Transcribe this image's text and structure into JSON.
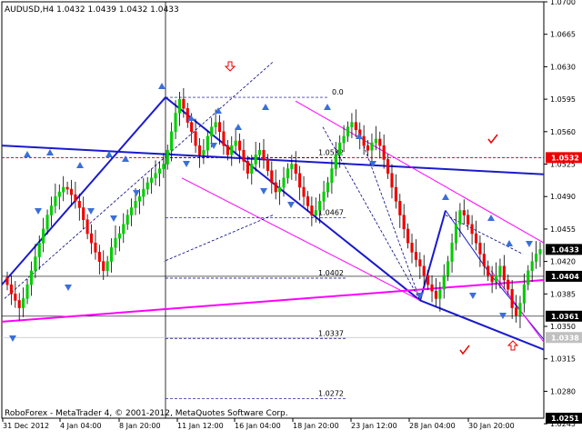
{
  "header": {
    "symbol_info": "AUDUSD,H4  1.0432 1.0439 1.0432 1.0433"
  },
  "footer": {
    "copyright": "RoboForex - MetaTrader 4, © 2001-2012, MetaQuotes Software Corp."
  },
  "colors": {
    "bull": "#00cc00",
    "bear": "#ee0000",
    "trend": "#1a1acc",
    "channel": "#ff00ff",
    "arrow": "#3a6fd8",
    "dashed": "#000080"
  },
  "chart_data": {
    "type": "candlestick",
    "symbol": "AUDUSD",
    "timeframe": "H4",
    "ylim": [
      1.0251,
      1.07
    ],
    "y_ticks": [
      "1.0700",
      "1.0665",
      "1.0630",
      "1.0595",
      "1.0560",
      "1.0525",
      "1.0490",
      "1.0455",
      "1.0420",
      "1.0385",
      "1.0350",
      "1.0315",
      "1.0280",
      "1.0245"
    ],
    "x_ticks": [
      "31 Dec 2012",
      "4 Jan 04:00",
      "8 Jan 20:00",
      "11 Jan 12:00",
      "16 Jan 04:00",
      "18 Jan 20:00",
      "23 Jan 12:00",
      "28 Jan 04:00",
      "30 Jan 20:00"
    ],
    "price_tags": [
      {
        "label": "1.0532",
        "value": 1.0532,
        "color": "#ee0000"
      },
      {
        "label": "1.0433",
        "value": 1.0433,
        "color": "#000000"
      },
      {
        "label": "1.0404",
        "value": 1.0404,
        "color": "#000000"
      },
      {
        "label": "1.0361",
        "value": 1.0361,
        "color": "#000000"
      },
      {
        "label": "1.0338",
        "value": 1.0338,
        "color": "#c0c0c0"
      },
      {
        "label": "1.0251",
        "value": 1.0251,
        "color": "#000000"
      }
    ],
    "fib_levels": [
      {
        "label": "0.0",
        "value": 1.0597
      },
      {
        "label": "1.0532",
        "value": 1.0532
      },
      {
        "label": "1.0467",
        "value": 1.0467
      },
      {
        "label": "1.0402",
        "value": 1.0402
      },
      {
        "label": "1.0337",
        "value": 1.0337
      },
      {
        "label": "1.0272",
        "value": 1.0272
      }
    ],
    "closes": [
      1.0395,
      1.0385,
      1.0378,
      1.037,
      1.038,
      1.0395,
      1.041,
      1.0425,
      1.044,
      1.0455,
      1.047,
      1.048,
      1.049,
      1.0495,
      1.05,
      1.0498,
      1.0492,
      1.0485,
      1.0478,
      1.0465,
      1.045,
      1.044,
      1.043,
      1.042,
      1.041,
      1.042,
      1.0435,
      1.0445,
      1.045,
      1.046,
      1.047,
      1.0478,
      1.0485,
      1.049,
      1.0498,
      1.0505,
      1.051,
      1.0515,
      1.052,
      1.0525,
      1.054,
      1.056,
      1.058,
      1.0595,
      1.0585,
      1.057,
      1.056,
      1.0545,
      1.0535,
      1.054,
      1.0555,
      1.0565,
      1.057,
      1.056,
      1.0545,
      1.0535,
      1.0545,
      1.055,
      1.054,
      1.0528,
      1.0515,
      1.0525,
      1.0535,
      1.054,
      1.053,
      1.0518,
      1.0505,
      1.0495,
      1.05,
      1.051,
      1.052,
      1.0525,
      1.0515,
      1.05,
      1.049,
      1.048,
      1.047,
      1.0475,
      1.0485,
      1.0495,
      1.0505,
      1.052,
      1.0535,
      1.0548,
      1.0555,
      1.0565,
      1.057,
      1.0562,
      1.0555,
      1.0545,
      1.054,
      1.0548,
      1.0552,
      1.0545,
      1.053,
      1.0515,
      1.05,
      1.0485,
      1.047,
      1.0455,
      1.044,
      1.043,
      1.0422,
      1.0415,
      1.0405,
      1.0395,
      1.0388,
      1.038,
      1.039,
      1.0405,
      1.042,
      1.044,
      1.046,
      1.0475,
      1.047,
      1.046,
      1.045,
      1.044,
      1.0428,
      1.0415,
      1.0405,
      1.0398,
      1.0405,
      1.0415,
      1.04,
      1.039,
      1.037,
      1.0362,
      1.0375,
      1.0395,
      1.041,
      1.042,
      1.0428,
      1.0433
    ]
  }
}
